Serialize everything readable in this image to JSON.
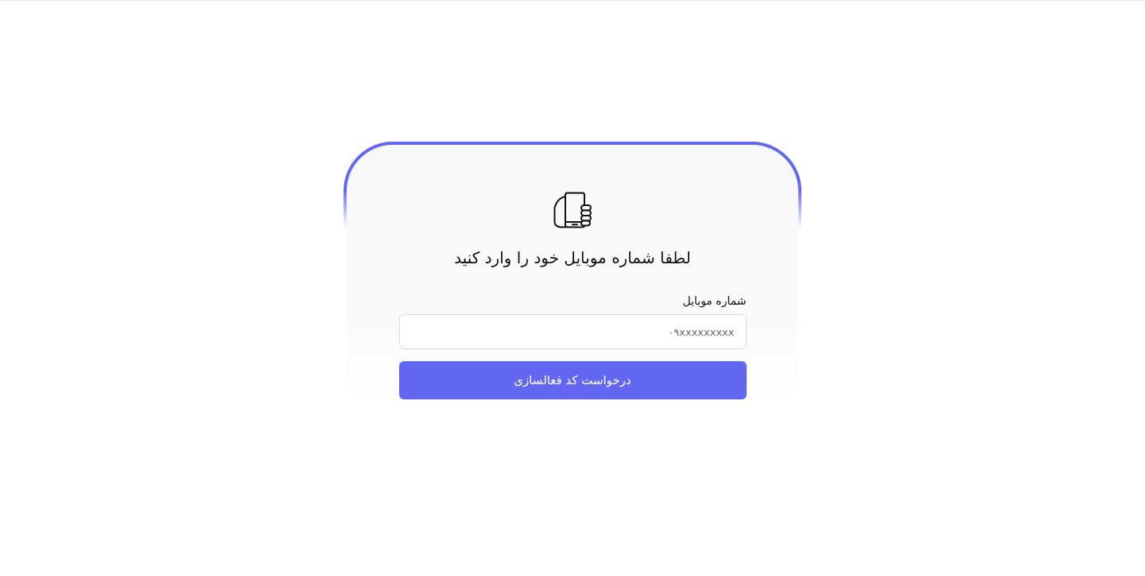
{
  "card": {
    "title": "لطفا شماره موبایل خود را وارد کنید",
    "field": {
      "label": "شماره موبایل",
      "placeholder": "۰۹xxxxxxxxx"
    },
    "submit_button": "درخواست کد فعالسازی"
  }
}
